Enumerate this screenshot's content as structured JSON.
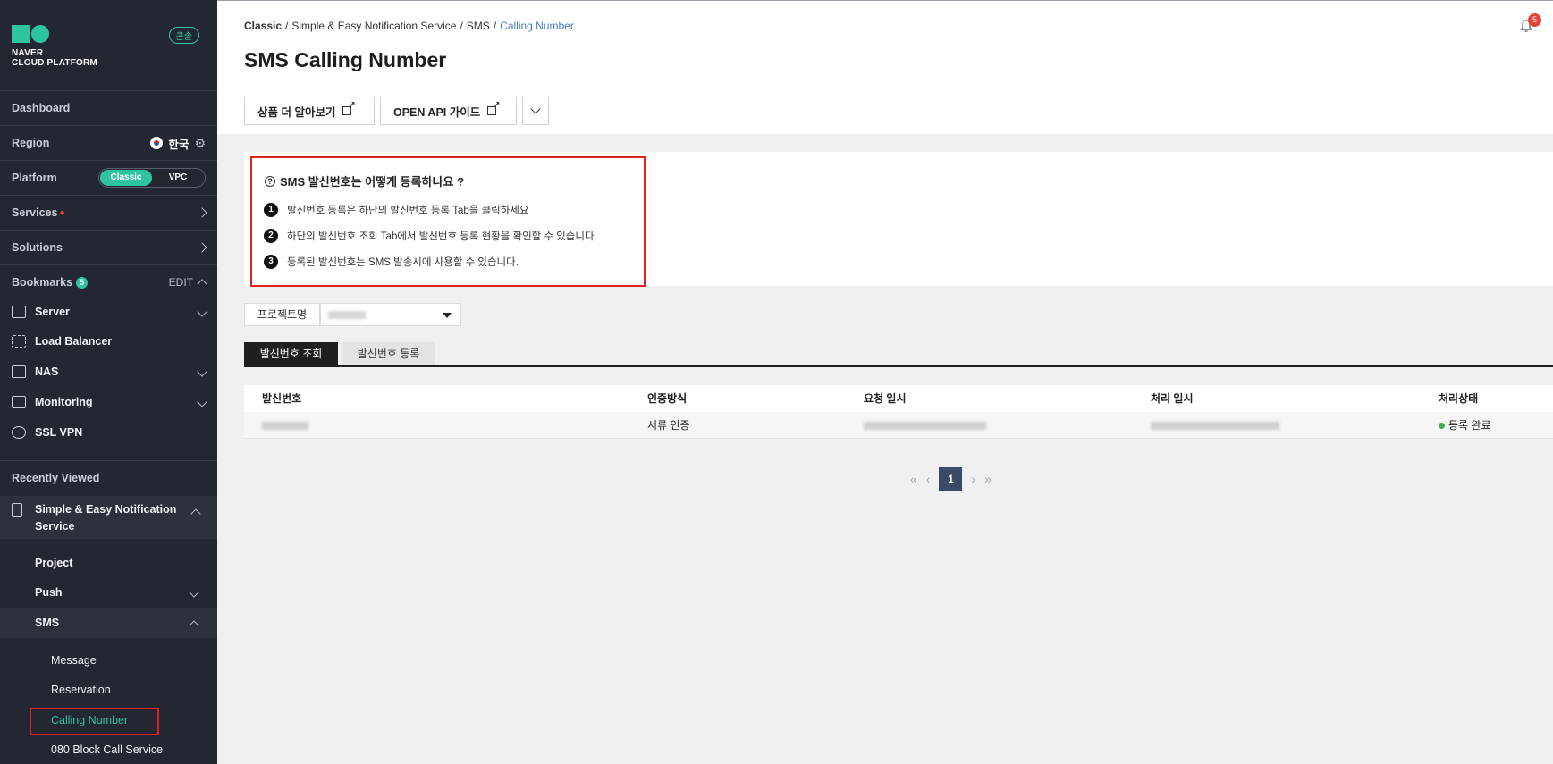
{
  "sidebar": {
    "logo_line1": "NAVER",
    "logo_line2": "CLOUD PLATFORM",
    "lang_badge": "콘솔",
    "dashboard": "Dashboard",
    "region_label": "Region",
    "region_value": "한국",
    "platform_label": "Platform",
    "platform_classic": "Classic",
    "platform_vpc": "VPC",
    "services": "Services",
    "solutions": "Solutions",
    "bookmarks": "Bookmarks",
    "bookmarks_count": "5",
    "edit": "EDIT",
    "bookmark_items": [
      "Server",
      "Load Balancer",
      "NAS",
      "Monitoring",
      "SSL VPN"
    ],
    "recently_viewed": "Recently Viewed",
    "recent_item_line1": "Simple & Easy Notification",
    "recent_item_line2": "Service",
    "sub_items": [
      "Project",
      "Push",
      "SMS"
    ],
    "sms_items": [
      "Message",
      "Reservation",
      "Calling Number",
      "080 Block Call Service"
    ]
  },
  "header": {
    "breadcrumb": [
      "Classic",
      "Simple & Easy Notification Service",
      "SMS",
      "Calling Number"
    ],
    "notification_count": "5",
    "title": "SMS Calling Number",
    "btn_product": "상품 더 알아보기",
    "btn_api": "OPEN API 가이드"
  },
  "info": {
    "title": "SMS 발신번호는 어떻게 등록하나요 ?",
    "steps": [
      "발신번호 등록은 하단의 발신번호 등록 Tab을 클릭하세요",
      "하단의 발신번호 조회 Tab에서 발신번호 등록 현황을 확인할 수 있습니다.",
      "등록된 발신번호는 SMS 발송시에 사용할 수 있습니다."
    ]
  },
  "filter": {
    "project_label": "프로젝트명"
  },
  "tabs": {
    "active": "발신번호 조회",
    "inactive": "발신번호 등록"
  },
  "table": {
    "headers": [
      "발신번호",
      "인증방식",
      "요청 일시",
      "처리 일시",
      "처리상태"
    ],
    "row": {
      "auth": "서류 인증",
      "status": "등록 완료"
    }
  },
  "pager": {
    "current": "1"
  },
  "colors": {
    "accent": "#2ec4a0",
    "highlight": "#e02020",
    "sidebar_bg": "#232730"
  }
}
